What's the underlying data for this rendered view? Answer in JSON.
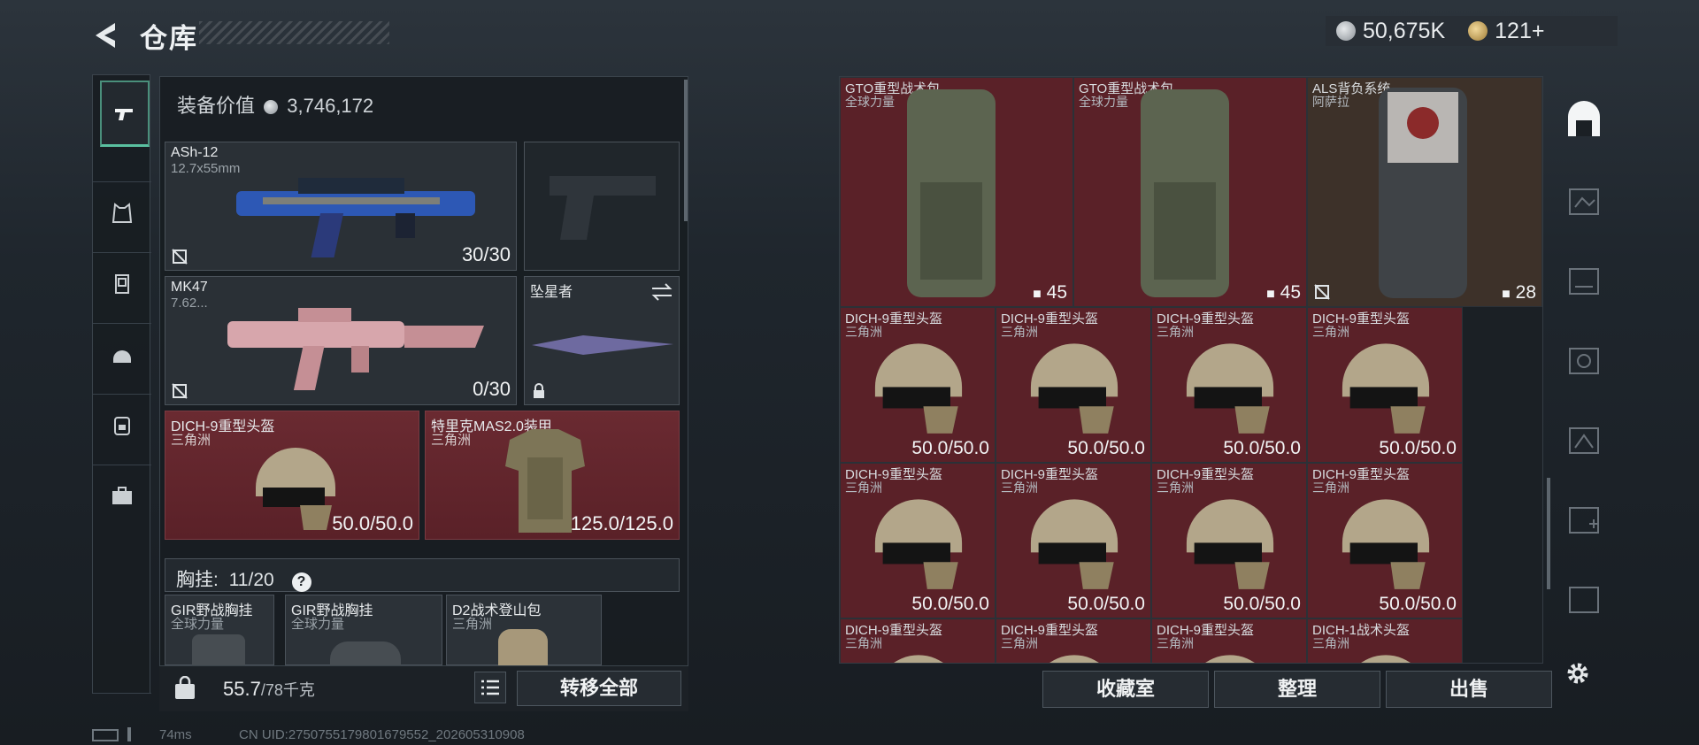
{
  "header": {
    "title": "仓库",
    "currency_1": "50,675K",
    "currency_2": "121+"
  },
  "equipment": {
    "label": "装备价值",
    "value": "3,746,172",
    "slots": {
      "primary": {
        "name": "ASh-12",
        "caliber": "12.7x55mm",
        "ammo": "30/30"
      },
      "secondary": {
        "name": "MK47",
        "caliber": "7.62...",
        "ammo": "0/30"
      },
      "melee": {
        "name": "坠星者"
      },
      "helmet": {
        "name": "DICH-9重型头盔",
        "maker": "三角洲",
        "durability": "50.0/50.0"
      },
      "armor": {
        "name": "特里克MAS2.0装甲",
        "maker": "三角洲",
        "durability": "125.0/125.0"
      }
    },
    "chest_rig": {
      "label": "胸挂:",
      "count": "11/20",
      "help": "?"
    },
    "rig_items": [
      {
        "name": "GIR野战胸挂",
        "maker": "全球力量"
      },
      {
        "name": "GIR野战胸挂",
        "maker": "全球力量"
      },
      {
        "name": "D2战术登山包",
        "maker": "三角洲"
      }
    ]
  },
  "footer": {
    "weight_value": "55.7",
    "weight_max": "/78千克",
    "transfer_all": "转移全部",
    "status_ping": "74ms",
    "uid": "CN UID:2750755179801679552_202605310908"
  },
  "storage": {
    "backpacks": [
      {
        "name": "GTO重型战术包",
        "maker": "全球力量",
        "value": "45"
      },
      {
        "name": "GTO重型战术包",
        "maker": "全球力量",
        "value": "45"
      },
      {
        "name": "ALS背负系统",
        "maker": "阿萨拉",
        "value": "28"
      }
    ],
    "helmets": [
      {
        "name": "DICH-9重型头盔",
        "maker": "三角洲",
        "durability": "50.0/50.0"
      },
      {
        "name": "DICH-9重型头盔",
        "maker": "三角洲",
        "durability": "50.0/50.0"
      },
      {
        "name": "DICH-9重型头盔",
        "maker": "三角洲",
        "durability": "50.0/50.0"
      },
      {
        "name": "DICH-9重型头盔",
        "maker": "三角洲",
        "durability": "50.0/50.0"
      },
      {
        "name": "DICH-9重型头盔",
        "maker": "三角洲",
        "durability": "50.0/50.0"
      },
      {
        "name": "DICH-9重型头盔",
        "maker": "三角洲",
        "durability": "50.0/50.0"
      },
      {
        "name": "DICH-9重型头盔",
        "maker": "三角洲",
        "durability": "50.0/50.0"
      },
      {
        "name": "DICH-9重型头盔",
        "maker": "三角洲",
        "durability": "50.0/50.0"
      },
      {
        "name": "DICH-9重型头盔",
        "maker": "三角洲",
        "durability": ""
      },
      {
        "name": "DICH-9重型头盔",
        "maker": "三角洲",
        "durability": ""
      },
      {
        "name": "DICH-9重型头盔",
        "maker": "三角洲",
        "durability": ""
      },
      {
        "name": "DICH-1战术头盔",
        "maker": "三角洲",
        "durability": ""
      }
    ],
    "buttons": {
      "collection": "收藏室",
      "sort": "整理",
      "sell": "出售"
    }
  },
  "colors": {
    "accent": "#5ac0a0",
    "item_red": "#5a2128",
    "item_brown": "#3d3129"
  }
}
